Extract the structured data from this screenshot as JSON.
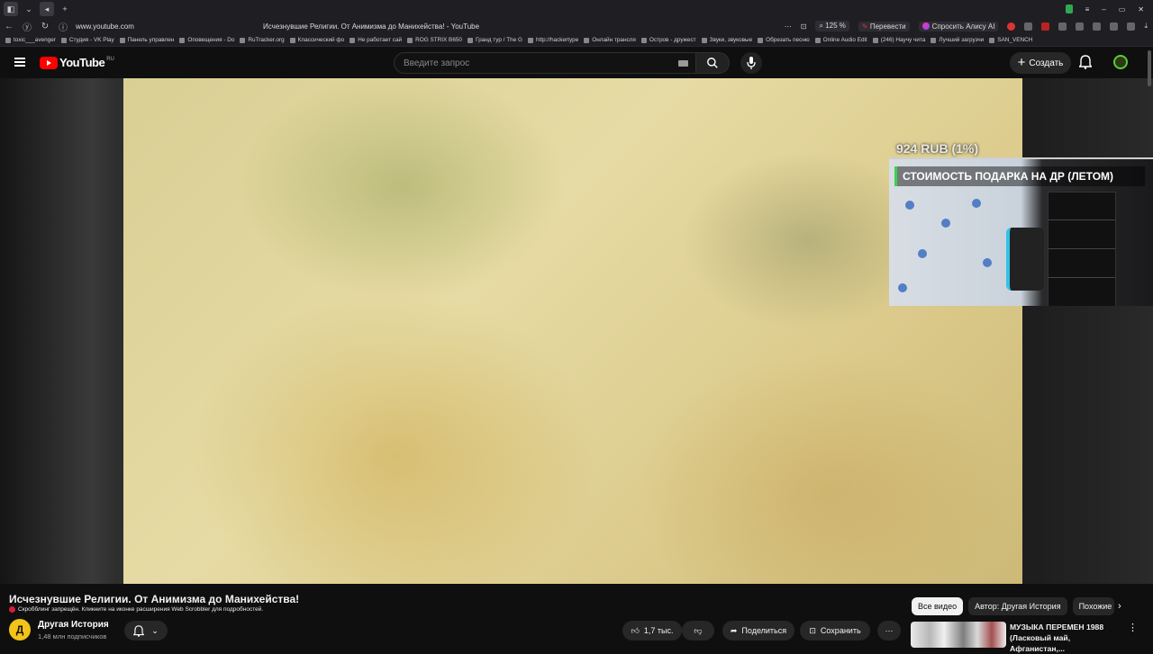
{
  "browser": {
    "url": "www.youtube.com",
    "page_title": "Исчезнувшие Религии. От Анимизма до Манихейства! - YouTube",
    "zoom": "125 %",
    "translate_label": "Перевести",
    "alice_label": "Спросить Алису AI",
    "bookmarks": [
      "toxic___avenger",
      "Студия - VK Play",
      "Панель управлен",
      "Оповещения - Do",
      "RuTracker.org",
      "Классический фо",
      "Не работает сай",
      "ROG STRIX B650",
      "Гранд тур / The G",
      "http://hackertype",
      "Онлайн трансля",
      "Остров - дружест",
      "Звуки, звуковые",
      "Обрезать песню",
      "Online Audio Edit",
      "(246) Научу чита",
      "Лучший загрузчи",
      "SAN_VENCH"
    ]
  },
  "youtube": {
    "logo_text": "YouTube",
    "region": "RU",
    "search_placeholder": "Введите запрос",
    "create_label": "Создать"
  },
  "overlay": {
    "donation_amount": "924 RUB (1%)",
    "goal_title": "СТОИМОСТЬ ПОДАРКА НА ДР (ЛЕТОМ)"
  },
  "video": {
    "title": "Исчезнувшие Религии. От Анимизма до Манихейства!",
    "scrobble_notice": "Скробблинг запрещён. Кликните на иконке расширения Web Scrobbler для подробностей.",
    "channel_name": "Другая История",
    "channel_initial": "Д",
    "subscribers": "1,48 млн подписчиков",
    "likes": "1,7 тыс.",
    "share_label": "Поделиться",
    "save_label": "Сохранить"
  },
  "sidebar": {
    "chips": [
      "Все видео",
      "Автор: Другая История",
      "Похожие"
    ],
    "rec_title": "МУЗЫКА ПЕРЕМЕН 1988 (Ласковый май, Афганистан,..."
  }
}
